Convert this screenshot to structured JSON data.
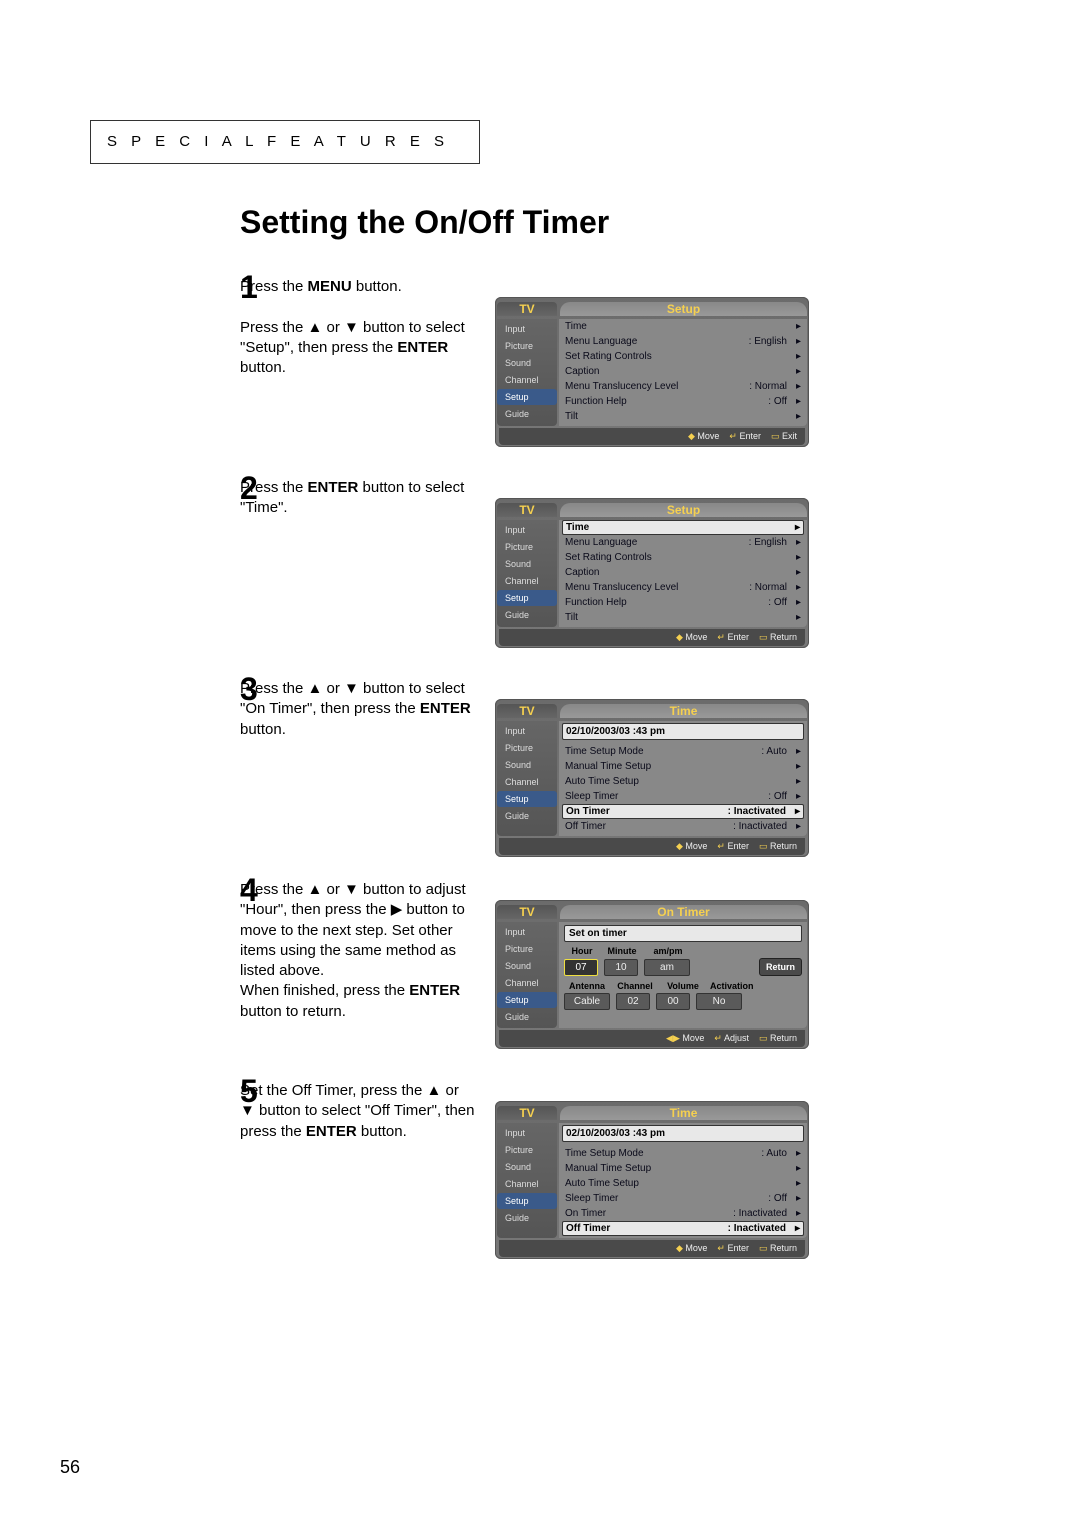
{
  "header": "S P E C I A L   F E A T U R E S",
  "title": "Setting the On/Off Timer",
  "page_number": "56",
  "glyphs": {
    "up": "▲",
    "down": "▼",
    "right": "▶",
    "arrow_small": "▸",
    "updown": "◆"
  },
  "sidebar_items": [
    "Input",
    "Picture",
    "Sound",
    "Channel",
    "Setup",
    "Guide"
  ],
  "steps": [
    {
      "num": "1",
      "instr_html": "Press the <b>MENU</b> button.<br><br>Press the ▲ or ▼ button to select \"Setup\", then press the <b>ENTER</b> button.",
      "menu_title": "Setup",
      "active_side": "Setup",
      "rows": [
        {
          "label": "Time",
          "val": "",
          "sel": false
        },
        {
          "label": "Menu Language",
          "val": ": English",
          "sel": false
        },
        {
          "label": "Set Rating Controls",
          "val": "",
          "sel": false
        },
        {
          "label": "Caption",
          "val": "",
          "sel": false
        },
        {
          "label": "Menu Translucency Level",
          "val": ": Normal",
          "sel": false
        },
        {
          "label": "Function Help",
          "val": ": Off",
          "sel": false
        },
        {
          "label": "Tilt",
          "val": "",
          "sel": false
        }
      ],
      "footer": [
        "Move",
        "Enter",
        "Exit"
      ]
    },
    {
      "num": "2",
      "instr_html": "Press the <b>ENTER</b> button to select \"Time\".",
      "menu_title": "Setup",
      "active_side": "Setup",
      "rows": [
        {
          "label": "Time",
          "val": "",
          "sel": true
        },
        {
          "label": "Menu Language",
          "val": ": English",
          "sel": false
        },
        {
          "label": "Set Rating Controls",
          "val": "",
          "sel": false
        },
        {
          "label": "Caption",
          "val": "",
          "sel": false
        },
        {
          "label": "Menu Translucency Level",
          "val": ": Normal",
          "sel": false
        },
        {
          "label": "Function Help",
          "val": ": Off",
          "sel": false
        },
        {
          "label": "Tilt",
          "val": "",
          "sel": false
        }
      ],
      "footer": [
        "Move",
        "Enter",
        "Return"
      ]
    },
    {
      "num": "3",
      "instr_html": "Press the ▲ or ▼ button to select \"On Timer\", then press the <b>ENTER</b> button.",
      "menu_title": "Time",
      "active_side": "Setup",
      "head": "02/10/2003/03 :43  pm",
      "rows": [
        {
          "label": "Time Setup Mode",
          "val": ": Auto",
          "sel": false
        },
        {
          "label": "Manual Time Setup",
          "val": "",
          "sel": false
        },
        {
          "label": "Auto Time Setup",
          "val": "",
          "sel": false
        },
        {
          "label": "Sleep Timer",
          "val": ": Off",
          "sel": false
        },
        {
          "label": "On Timer",
          "val": ": Inactivated",
          "sel": true
        },
        {
          "label": "Off Timer",
          "val": ": Inactivated",
          "sel": false
        }
      ],
      "footer": [
        "Move",
        "Enter",
        "Return"
      ]
    },
    {
      "num": "4",
      "instr_html": "Press the ▲ or ▼ button to adjust \"Hour\", then press the ▶ button to move to the next step. Set other items using the same method as listed above.<br>When finished, press the <b>ENTER</b> button to return.",
      "menu_title": "On Timer",
      "active_side": "Setup",
      "ontimer": {
        "title": "Set on timer",
        "row1_labels": [
          "Hour",
          "Minute",
          "am/pm"
        ],
        "row1_values": [
          {
            "v": "07",
            "sel": true
          },
          {
            "v": "10",
            "sel": false
          },
          {
            "v": "am",
            "sel": false
          }
        ],
        "return_label": "Return",
        "row2_labels": [
          "Antenna",
          "Channel",
          "Volume",
          "Activation"
        ],
        "row2_values": [
          {
            "v": "Cable",
            "sel": false
          },
          {
            "v": "02",
            "sel": false
          },
          {
            "v": "00",
            "sel": false
          },
          {
            "v": "No",
            "sel": false
          }
        ]
      },
      "footer": [
        "Move",
        "Adjust",
        "Return"
      ]
    },
    {
      "num": "5",
      "instr_html": "Set the Off Timer, press the ▲ or ▼ button to select \"Off Timer\", then press the <b>ENTER</b> button.",
      "menu_title": "Time",
      "active_side": "Setup",
      "head": "02/10/2003/03 :43  pm",
      "rows": [
        {
          "label": "Time Setup Mode",
          "val": ": Auto",
          "sel": false
        },
        {
          "label": "Manual Time Setup",
          "val": "",
          "sel": false
        },
        {
          "label": "Auto Time Setup",
          "val": "",
          "sel": false
        },
        {
          "label": "Sleep Timer",
          "val": ": Off",
          "sel": false
        },
        {
          "label": "On Timer",
          "val": ": Inactivated",
          "sel": false
        },
        {
          "label": "Off Timer",
          "val": ": Inactivated",
          "sel": true
        }
      ],
      "footer": [
        "Move",
        "Enter",
        "Return"
      ]
    }
  ]
}
